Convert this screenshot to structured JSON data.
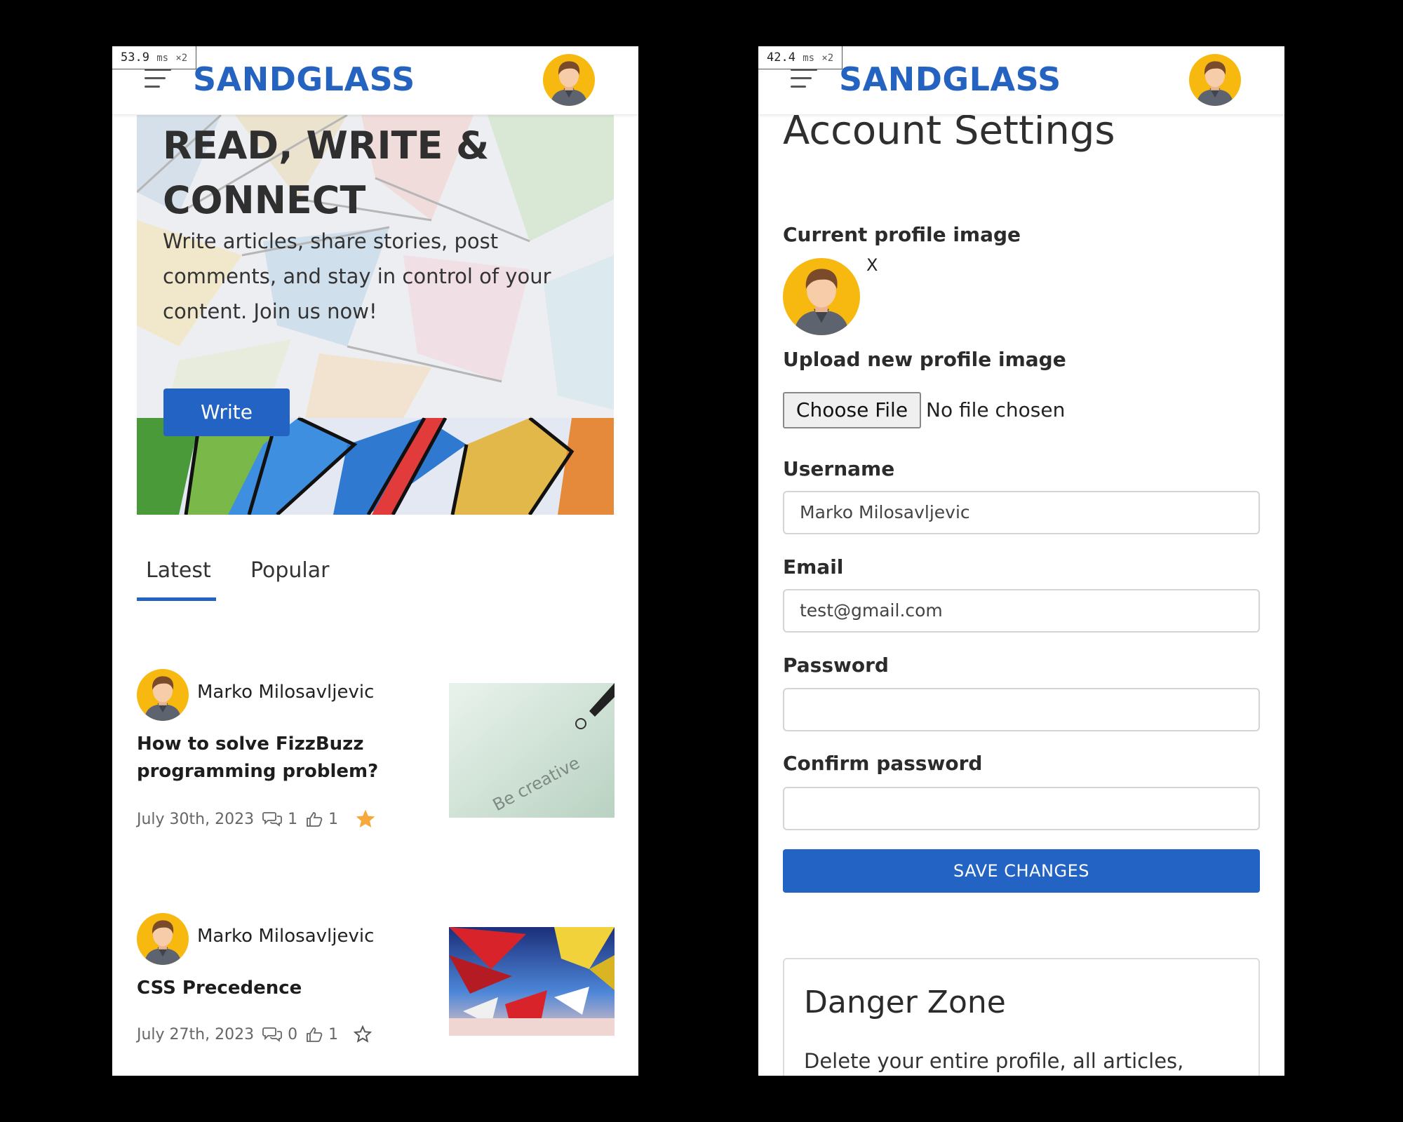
{
  "left_screen": {
    "timing": {
      "value": "53.9",
      "unit": "ms",
      "multiplier": "×2"
    },
    "brand": "SANDGLASS",
    "hero": {
      "title": "READ, WRITE & CONNECT",
      "text": "Write articles, share stories, post comments, and stay in control of your content. Join us now!",
      "write_label": "Write"
    },
    "tabs": [
      {
        "label": "Latest",
        "active": true
      },
      {
        "label": "Popular",
        "active": false
      }
    ],
    "articles": [
      {
        "author": "Marko Milosavljevic",
        "title": "How to solve FizzBuzz programming problem?",
        "date": "July 30th, 2023",
        "comments": "1",
        "likes": "1",
        "favorited": true,
        "thumb_text": "Be creative"
      },
      {
        "author": "Marko Milosavljevic",
        "title": "CSS Precedence",
        "date": "July 27th, 2023",
        "comments": "0",
        "likes": "1",
        "favorited": false
      }
    ]
  },
  "right_screen": {
    "timing": {
      "value": "42.4",
      "unit": "ms",
      "multiplier": "×2"
    },
    "brand": "SANDGLASS",
    "page_title": "Account Settings",
    "current_image_label": "Current profile image",
    "remove_label": "X",
    "upload_label": "Upload new profile image",
    "choose_file_label": "Choose File",
    "no_file_text": "No file chosen",
    "username": {
      "label": "Username",
      "value": "Marko Milosavljevic"
    },
    "email": {
      "label": "Email",
      "value": "test@gmail.com"
    },
    "password": {
      "label": "Password",
      "value": ""
    },
    "confirm_password": {
      "label": "Confirm password",
      "value": ""
    },
    "save_label": "SAVE CHANGES",
    "danger_zone": {
      "title": "Danger Zone",
      "text": "Delete your entire profile, all articles,"
    }
  },
  "colors": {
    "brand": "#2563c0",
    "button": "#2363c3",
    "star_filled": "#f6a83c"
  }
}
